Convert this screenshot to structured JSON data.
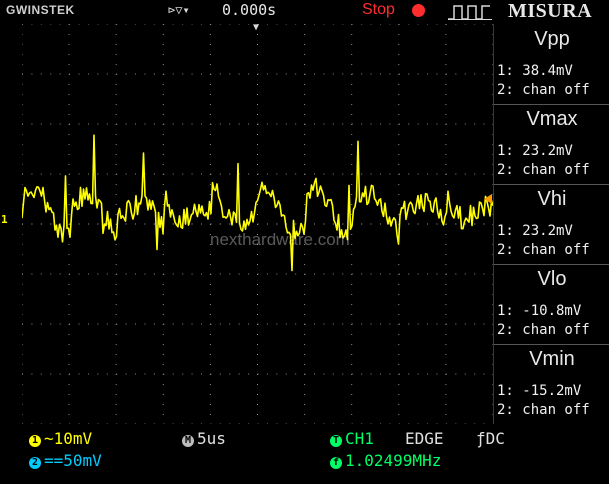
{
  "topbar": {
    "brand": "GWINSTEK",
    "trigger_delay": "0.000s",
    "run_state": "Stop",
    "menu_title": "MISURA",
    "trigger_icon": "expand-arrow-icon",
    "pulse_icon": "pulse-wave-icon"
  },
  "screen": {
    "watermark": "nexthardware.com",
    "ch1_marker": "1",
    "trigger_marker": "▼"
  },
  "measurements": [
    {
      "label": "Vpp",
      "ch1": "1: 38.4mV",
      "ch2": "2: chan off"
    },
    {
      "label": "Vmax",
      "ch1": "1: 23.2mV",
      "ch2": "2: chan off"
    },
    {
      "label": "Vhi",
      "ch1": "1: 23.2mV",
      "ch2": "2: chan off"
    },
    {
      "label": "Vlo",
      "ch1": "1: -10.8mV",
      "ch2": "2: chan off"
    },
    {
      "label": "Vmin",
      "ch1": "1: -15.2mV",
      "ch2": "2: chan off"
    }
  ],
  "bottombar": {
    "ch1_badge": "1",
    "ch1_coupling": "~",
    "ch1_scale": "10mV",
    "ch2_badge": "2",
    "ch2_coupling": "==",
    "ch2_scale": "50mV",
    "timebase_badge": "M",
    "timebase": "5us",
    "trig_badge": "T",
    "trigger_source": "CH1",
    "trigger_type": "EDGE",
    "trigger_coupling": "ƒDC",
    "freq_badge": "f",
    "frequency": "1.02499MHz"
  },
  "colors": {
    "ch1": "#ffff00",
    "ch2": "#00ccff",
    "timebase": "#e0e0e0",
    "trigger": "#00ff66",
    "stop": "#ff2d2d",
    "trigger_level": "#ff9a00"
  }
}
